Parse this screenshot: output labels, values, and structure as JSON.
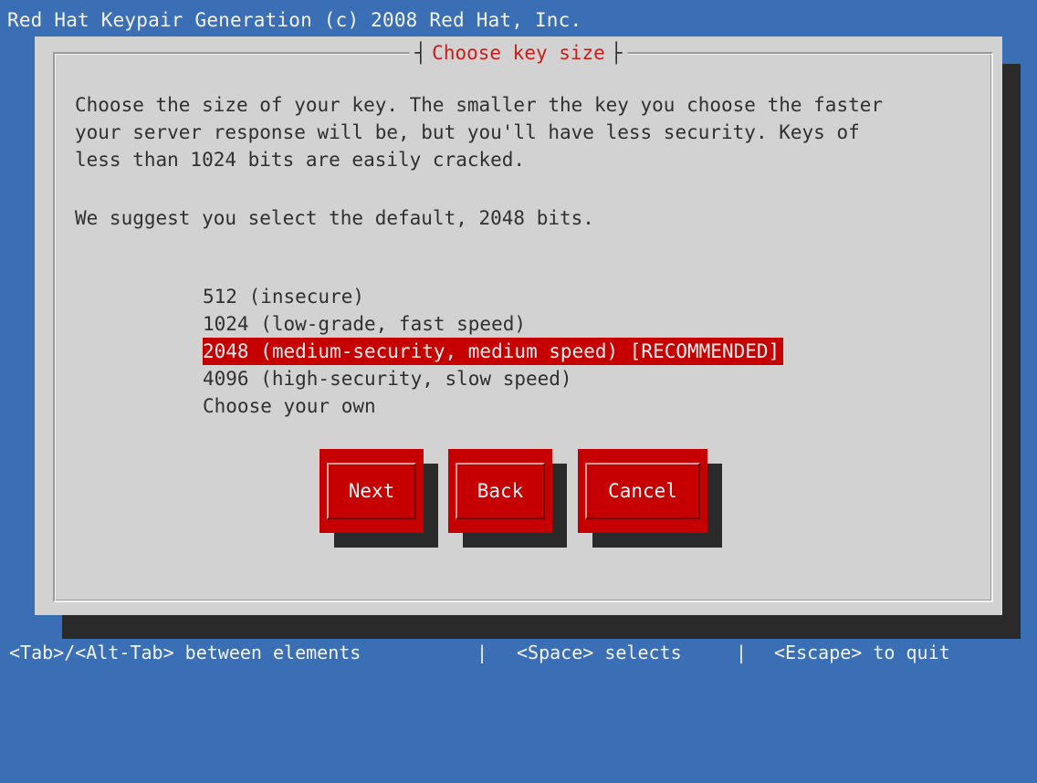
{
  "app": {
    "title": "Red Hat Keypair Generation (c) 2008 Red Hat, Inc."
  },
  "dialog": {
    "title": "Choose key size",
    "paragraph1": "Choose the size of your key. The smaller the key you choose the faster\nyour server response will be, but you'll have less security. Keys of\nless than 1024 bits are easily cracked.",
    "paragraph2": "We suggest you select the default, 2048 bits.",
    "options": [
      {
        "label": "512 (insecure)",
        "selected": false
      },
      {
        "label": "1024 (low-grade, fast speed)",
        "selected": false
      },
      {
        "label": "2048 (medium-security, medium speed) [RECOMMENDED]",
        "selected": true
      },
      {
        "label": "4096 (high-security, slow speed)",
        "selected": false
      },
      {
        "label": "Choose your own",
        "selected": false
      }
    ],
    "buttons": {
      "next": "Next",
      "back": "Back",
      "cancel": "Cancel"
    }
  },
  "statusbar": {
    "tab_hint": "<Tab>/<Alt-Tab> between elements",
    "space_hint": "<Space> selects",
    "escape_hint": "<Escape> to quit",
    "separator": "|"
  },
  "colors": {
    "desktop_blue": "#3b6fb5",
    "dialog_gray": "#d2d2d2",
    "accent_red": "#c60000",
    "title_red": "#c7201c"
  }
}
